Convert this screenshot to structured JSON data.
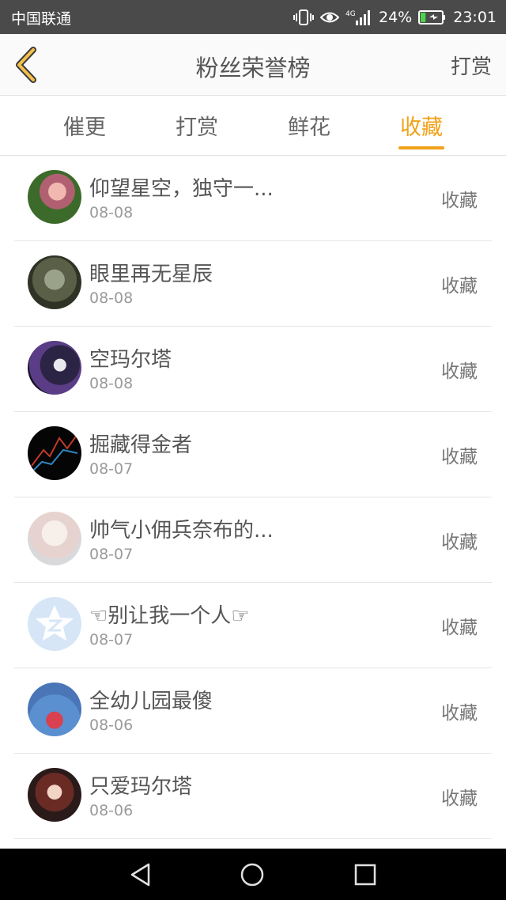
{
  "status_bar": {
    "carrier": "中国联通",
    "network": "4G",
    "battery_percent": "24%",
    "time": "23:01",
    "battery_level": 0.24
  },
  "header": {
    "title": "粉丝荣誉榜",
    "right_link": "打赏",
    "back_icon": "chevron-left-icon",
    "accent_color": "#f0a21a"
  },
  "tabs": [
    {
      "label": "催更",
      "active": false
    },
    {
      "label": "打赏",
      "active": false
    },
    {
      "label": "鲜花",
      "active": false
    },
    {
      "label": "收藏",
      "active": true
    }
  ],
  "fans": [
    {
      "name": "仰望星空，独守一...",
      "date": "08-08",
      "action": "收藏"
    },
    {
      "name": "眼里再无星辰",
      "date": "08-08",
      "action": "收藏"
    },
    {
      "name": "空玛尔塔",
      "date": "08-08",
      "action": "收藏"
    },
    {
      "name": "掘藏得金者",
      "date": "08-07",
      "action": "收藏"
    },
    {
      "name": "帅气小佣兵奈布的...",
      "date": "08-07",
      "action": "收藏"
    },
    {
      "name": "☜别让我一个人☞",
      "date": "08-07",
      "action": "收藏"
    },
    {
      "name": "全幼儿园最傻",
      "date": "08-06",
      "action": "收藏"
    },
    {
      "name": "只爱玛尔塔",
      "date": "08-06",
      "action": "收藏"
    }
  ],
  "nav": {
    "back_icon": "triangle-back-icon",
    "home_icon": "circle-home-icon",
    "recents_icon": "square-recents-icon"
  }
}
